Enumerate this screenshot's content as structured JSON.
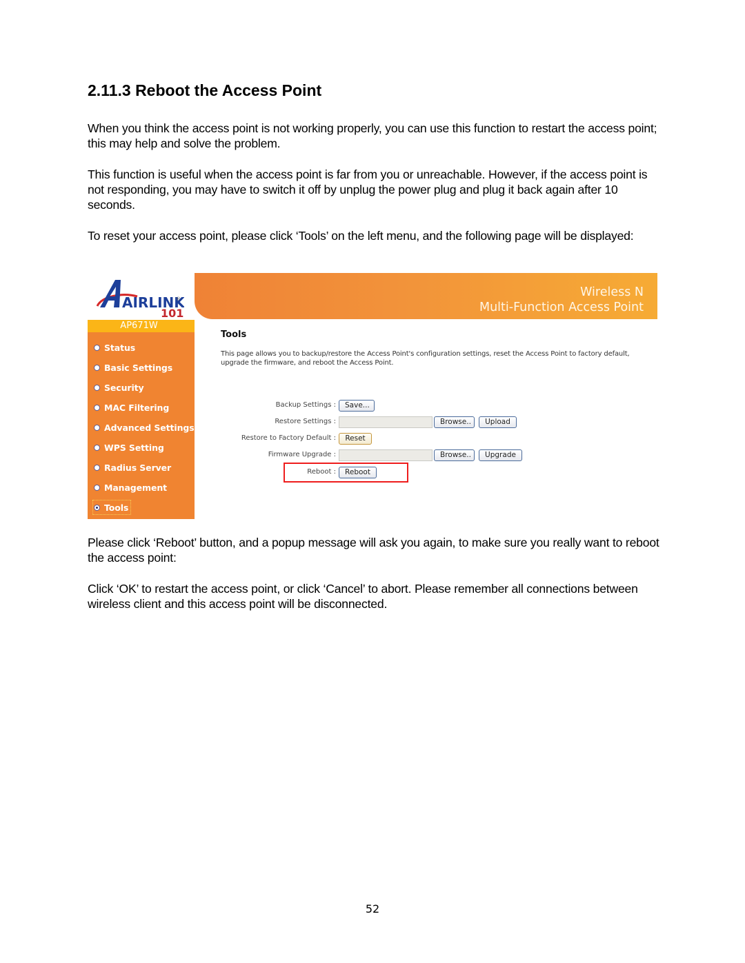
{
  "section": {
    "title": "2.11.3 Reboot the Access Point"
  },
  "paragraphs": [
    "When you think the access point is not working properly, you can use this function to restart the access point; this may help and solve the problem.",
    "This function is useful when the access point is far from you or unreachable. However, if the access point is not responding, you may have to switch it off by unplug the power plug and plug it back again after 10 seconds.",
    "To reset your access point, please click ‘Tools’ on the left menu, and the following page will be displayed:",
    "Please click ‘Reboot’ button, and a popup message will ask you again, to make sure you really want to reboot the access point:",
    "Click ‘OK’ to restart the access point, or click ‘Cancel’ to abort. Please remember all connections between wireless client and this access point will be disconnected."
  ],
  "screenshot": {
    "logo": {
      "brand": "AIRLINK",
      "suffix": "101",
      "registered": "®"
    },
    "header": {
      "line1": "Wireless N",
      "line2": "Multi-Function Access Point"
    },
    "model": "AP671W",
    "sidebar": {
      "items": [
        {
          "label": "Status",
          "active": false
        },
        {
          "label": "Basic Settings",
          "active": false
        },
        {
          "label": "Security",
          "active": false
        },
        {
          "label": "MAC Filtering",
          "active": false
        },
        {
          "label": "Advanced Settings",
          "active": false
        },
        {
          "label": "WPS Setting",
          "active": false
        },
        {
          "label": "Radius Server",
          "active": false
        },
        {
          "label": "Management",
          "active": false
        },
        {
          "label": "Tools",
          "active": true
        }
      ]
    },
    "content": {
      "title": "Tools",
      "description": "This page allows you to backup/restore the Access Point's configuration settings, reset the Access Point to factory default, upgrade the firmware, and reboot the Access Point.",
      "rows": {
        "backup": {
          "label": "Backup Settings :",
          "button": "Save..."
        },
        "restore": {
          "label": "Restore Settings :",
          "file_value": "",
          "browse": "Browse..",
          "button": "Upload"
        },
        "factory": {
          "label": "Restore to Factory Default :",
          "button": "Reset"
        },
        "firmware": {
          "label": "Firmware Upgrade :",
          "file_value": "",
          "browse": "Browse..",
          "button": "Upgrade"
        },
        "reboot": {
          "label": "Reboot :",
          "button": "Reboot"
        }
      }
    },
    "colors": {
      "sidebar": "#f08431",
      "model_bar": "#fbb517",
      "header_start": "#ef8236",
      "header_end": "#f6ab35",
      "highlight": "#ee1c1c"
    }
  },
  "page_number": "52"
}
